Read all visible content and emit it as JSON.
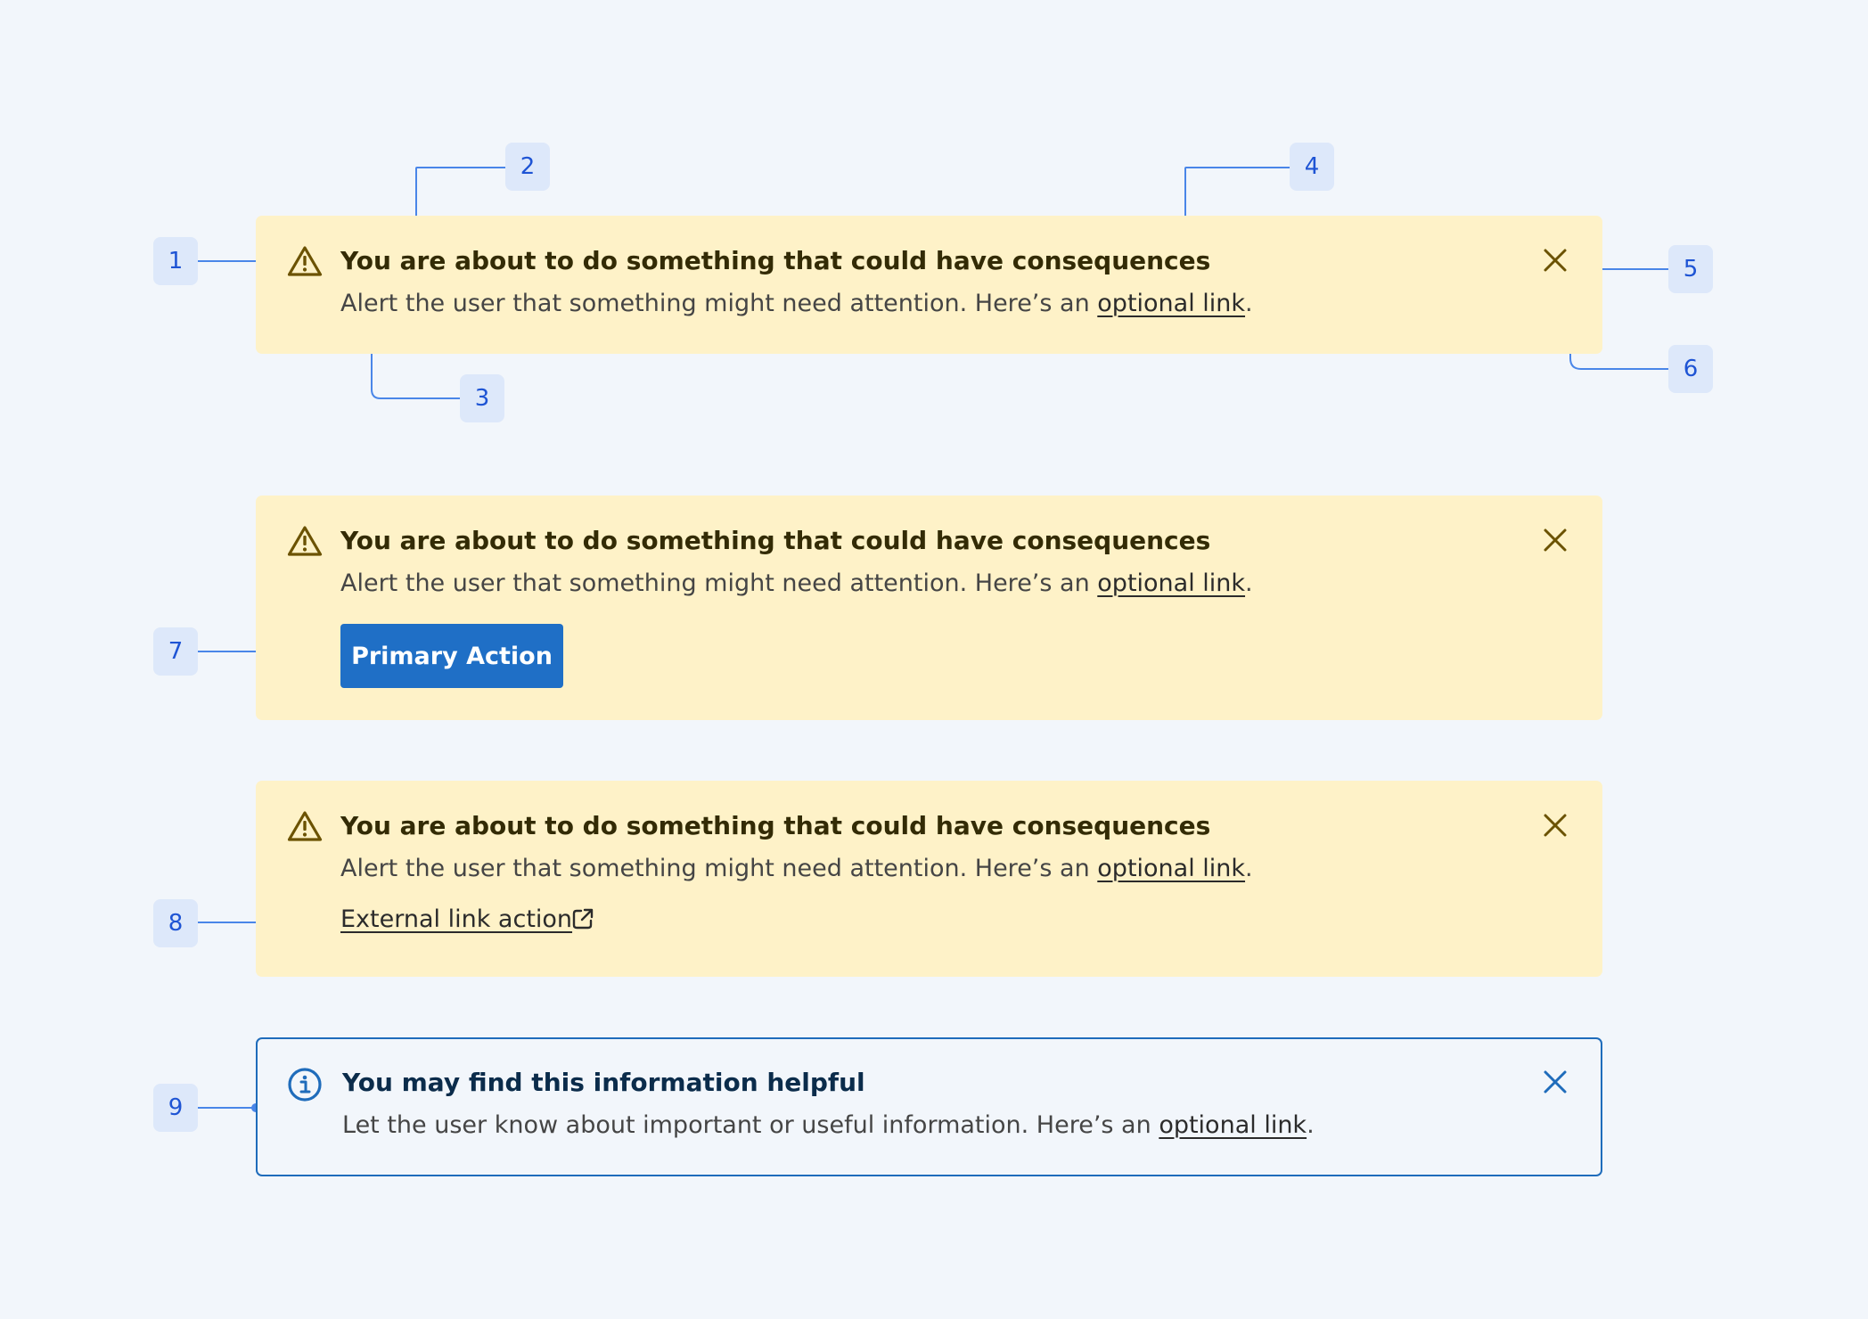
{
  "alerts": [
    {
      "type": "warning",
      "title": "You are about to do something that could have consequences",
      "description": "Alert the user that something might need attention. Here’s an ",
      "link_text": "optional link",
      "suffix": "."
    },
    {
      "type": "warning",
      "title": "You are about to do something that could have consequences",
      "description": "Alert the user that something might need attention. Here’s an ",
      "link_text": "optional link",
      "suffix": ".",
      "primary_action": "Primary Action"
    },
    {
      "type": "warning",
      "title": "You are about to do something that could have consequences",
      "description": "Alert the user that something might need attention. Here’s an ",
      "link_text": "optional link",
      "suffix": ".",
      "external_link": "External link action"
    },
    {
      "type": "info",
      "title": "You may find this information helpful",
      "description": "Let the user know about important or useful information. Here’s an ",
      "link_text": "optional link",
      "suffix": "."
    }
  ],
  "annotations": [
    "1",
    "2",
    "3",
    "4",
    "5",
    "6",
    "7",
    "8",
    "9"
  ],
  "colors": {
    "page_background": "#f2f6fb",
    "warning_background": "#fef2c8",
    "warning_icon": "#6b5200",
    "info_border": "#1f6cbb",
    "primary_button": "#1f6fc6",
    "annotation_badge": "#dde8fa",
    "annotation_text": "#1e54d4",
    "annotation_line": "#4a86e8"
  },
  "icons": {
    "warning": "warning-triangle-icon",
    "info": "info-circle-icon",
    "close": "close-icon",
    "external": "external-link-icon"
  }
}
